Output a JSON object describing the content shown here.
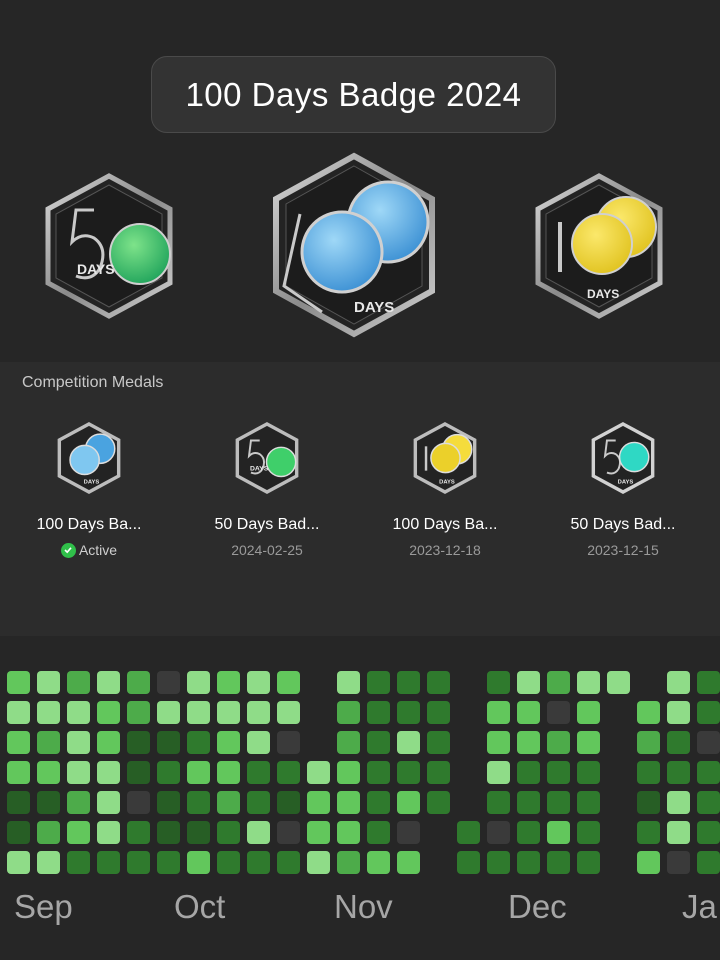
{
  "header": {
    "title": "100 Days Badge 2024"
  },
  "hero_badges": [
    {
      "name": "50 Days Badge",
      "numeral": "50",
      "word": "DAYS",
      "color": "green"
    },
    {
      "name": "100 Days Badge",
      "numeral": "100",
      "word": "DAYS",
      "color": "blue"
    },
    {
      "name": "100 Days Badge",
      "numeral": "100",
      "word": "DAYS",
      "color": "yellow"
    }
  ],
  "medals": {
    "heading": "Competition Medals",
    "items": [
      {
        "title": "100 Days Ba...",
        "subtitle": "Active",
        "active": true,
        "icon": "blue-100-days-badge-icon"
      },
      {
        "title": "50 Days Bad...",
        "subtitle": "2024-02-25",
        "active": false,
        "icon": "green-50-days-badge-icon"
      },
      {
        "title": "100 Days Ba...",
        "subtitle": "2023-12-18",
        "active": false,
        "icon": "yellow-100-days-badge-icon"
      },
      {
        "title": "50 Days Bad...",
        "subtitle": "2023-12-15",
        "active": false,
        "icon": "teal-50-days-badge-icon"
      }
    ]
  },
  "heatmap": {
    "months": [
      "Sep",
      "Oct",
      "Nov",
      "Dec",
      "Ja"
    ],
    "level_colors": [
      "#3a3a3a",
      "#275e25",
      "#2f7a2d",
      "#4dab4a",
      "#62c75c",
      "#8fdc88"
    ],
    "weeks": [
      [
        4,
        5,
        4,
        4,
        1,
        1,
        5
      ],
      [
        5,
        5,
        3,
        4,
        1,
        3,
        5
      ],
      [
        3,
        5,
        5,
        5,
        3,
        4,
        2
      ],
      [
        5,
        4,
        4,
        5,
        5,
        5,
        2
      ],
      [
        3,
        3,
        1,
        1,
        0,
        2,
        2
      ],
      [
        0,
        5,
        1,
        2,
        1,
        1,
        2
      ],
      [
        5,
        5,
        2,
        4,
        2,
        1,
        4
      ],
      [
        4,
        5,
        4,
        4,
        3,
        2,
        2
      ],
      [
        5,
        5,
        5,
        2,
        2,
        5,
        2
      ],
      [
        4,
        5,
        0,
        2,
        1,
        0,
        2
      ],
      [
        -1,
        -1,
        -1,
        5,
        4,
        4,
        5
      ],
      [
        5,
        3,
        3,
        4,
        4,
        4,
        3
      ],
      [
        2,
        2,
        2,
        2,
        2,
        2,
        4
      ],
      [
        2,
        2,
        5,
        2,
        4,
        0,
        4
      ],
      [
        2,
        2,
        2,
        2,
        2,
        -1,
        -1
      ],
      [
        -1,
        -1,
        -1,
        -1,
        -1,
        2,
        2
      ],
      [
        2,
        4,
        4,
        5,
        2,
        0,
        2
      ],
      [
        5,
        4,
        4,
        2,
        2,
        2,
        2
      ],
      [
        3,
        0,
        3,
        2,
        2,
        4,
        2
      ],
      [
        5,
        4,
        4,
        2,
        2,
        2,
        2
      ],
      [
        5,
        -1,
        -1,
        -1,
        -1,
        -1,
        -1
      ],
      [
        -1,
        4,
        3,
        2,
        1,
        2,
        4
      ],
      [
        5,
        5,
        2,
        2,
        5,
        5,
        0
      ],
      [
        2,
        2,
        0,
        2,
        2,
        2,
        2
      ]
    ]
  }
}
